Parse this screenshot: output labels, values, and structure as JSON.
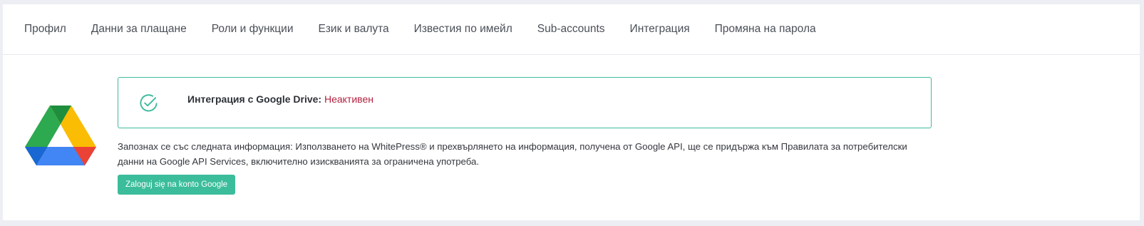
{
  "tabs": [
    {
      "label": "Профил"
    },
    {
      "label": "Данни за плащане"
    },
    {
      "label": "Роли и функции"
    },
    {
      "label": "Език и валута"
    },
    {
      "label": "Известия по имейл"
    },
    {
      "label": "Sub-accounts"
    },
    {
      "label": "Интеграция"
    },
    {
      "label": "Промяна на парола"
    }
  ],
  "integration": {
    "logo_icon": "google-drive-logo",
    "status_icon": "check-circle-icon",
    "status_label": "Интеграция с Google Drive: ",
    "status_value": "Неактивен",
    "info_text": "Запознах се със следната информация: Използването на WhitePress® и прехвърлянето на информация, получена от Google API, ще се придържа към Правилата за потребителски данни на Google API Services, включително изискванията за ограничена употреба.",
    "login_button": "Zaloguj się na konto Google"
  },
  "colors": {
    "accent": "#3bbd9b",
    "inactive": "#b3203f",
    "background": "#eceef3"
  }
}
